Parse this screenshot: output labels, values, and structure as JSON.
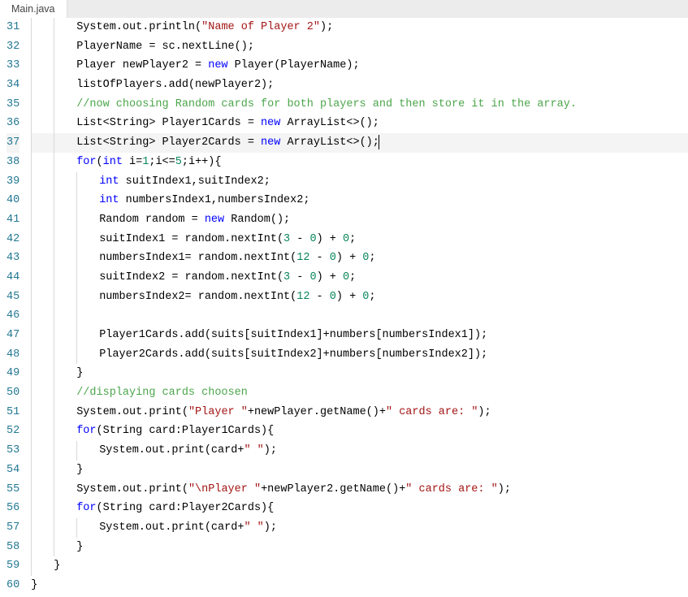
{
  "tab": {
    "filename": "Main.java"
  },
  "lines": [
    {
      "num": 31,
      "indent": 2,
      "tokens": [
        {
          "t": "System.out.println(",
          "c": "code"
        },
        {
          "t": "\"Name of Player 2\"",
          "c": "str"
        },
        {
          "t": ");",
          "c": "code"
        }
      ]
    },
    {
      "num": 32,
      "indent": 2,
      "tokens": [
        {
          "t": "PlayerName = sc.nextLine();",
          "c": "code"
        }
      ]
    },
    {
      "num": 33,
      "indent": 2,
      "tokens": [
        {
          "t": "Player newPlayer2 = ",
          "c": "code"
        },
        {
          "t": "new",
          "c": "kw"
        },
        {
          "t": " Player(PlayerName);",
          "c": "code"
        }
      ]
    },
    {
      "num": 34,
      "indent": 2,
      "tokens": [
        {
          "t": "listOfPlayers.add(newPlayer2);",
          "c": "code"
        }
      ]
    },
    {
      "num": 35,
      "indent": 2,
      "tokens": [
        {
          "t": "//now choosing Random cards for both players and then store it in the array.",
          "c": "cmt"
        }
      ]
    },
    {
      "num": 36,
      "indent": 2,
      "tokens": [
        {
          "t": "List<String> Player1Cards = ",
          "c": "code"
        },
        {
          "t": "new",
          "c": "kw"
        },
        {
          "t": " ArrayList<>();",
          "c": "code"
        }
      ]
    },
    {
      "num": 37,
      "indent": 2,
      "highlighted": true,
      "cursor": true,
      "tokens": [
        {
          "t": "List<String> Player2Cards = ",
          "c": "code"
        },
        {
          "t": "new",
          "c": "kw"
        },
        {
          "t": " ArrayList<>();",
          "c": "code"
        }
      ]
    },
    {
      "num": 38,
      "indent": 2,
      "tokens": [
        {
          "t": "for",
          "c": "kw"
        },
        {
          "t": "(",
          "c": "code"
        },
        {
          "t": "int",
          "c": "kw"
        },
        {
          "t": " i=",
          "c": "code"
        },
        {
          "t": "1",
          "c": "num"
        },
        {
          "t": ";i<=",
          "c": "code"
        },
        {
          "t": "5",
          "c": "num"
        },
        {
          "t": ";i++){",
          "c": "code"
        }
      ]
    },
    {
      "num": 39,
      "indent": 3,
      "tokens": [
        {
          "t": "int",
          "c": "kw"
        },
        {
          "t": " suitIndex1,suitIndex2;",
          "c": "code"
        }
      ]
    },
    {
      "num": 40,
      "indent": 3,
      "tokens": [
        {
          "t": "int",
          "c": "kw"
        },
        {
          "t": " numbersIndex1,numbersIndex2;",
          "c": "code"
        }
      ]
    },
    {
      "num": 41,
      "indent": 3,
      "tokens": [
        {
          "t": "Random random = ",
          "c": "code"
        },
        {
          "t": "new",
          "c": "kw"
        },
        {
          "t": " Random();",
          "c": "code"
        }
      ]
    },
    {
      "num": 42,
      "indent": 3,
      "tokens": [
        {
          "t": "suitIndex1 = random.nextInt(",
          "c": "code"
        },
        {
          "t": "3",
          "c": "num"
        },
        {
          "t": " - ",
          "c": "code"
        },
        {
          "t": "0",
          "c": "num"
        },
        {
          "t": ") + ",
          "c": "code"
        },
        {
          "t": "0",
          "c": "num"
        },
        {
          "t": ";",
          "c": "code"
        }
      ]
    },
    {
      "num": 43,
      "indent": 3,
      "tokens": [
        {
          "t": "numbersIndex1= random.nextInt(",
          "c": "code"
        },
        {
          "t": "12",
          "c": "num"
        },
        {
          "t": " - ",
          "c": "code"
        },
        {
          "t": "0",
          "c": "num"
        },
        {
          "t": ") + ",
          "c": "code"
        },
        {
          "t": "0",
          "c": "num"
        },
        {
          "t": ";",
          "c": "code"
        }
      ]
    },
    {
      "num": 44,
      "indent": 3,
      "tokens": [
        {
          "t": "suitIndex2 = random.nextInt(",
          "c": "code"
        },
        {
          "t": "3",
          "c": "num"
        },
        {
          "t": " - ",
          "c": "code"
        },
        {
          "t": "0",
          "c": "num"
        },
        {
          "t": ") + ",
          "c": "code"
        },
        {
          "t": "0",
          "c": "num"
        },
        {
          "t": ";",
          "c": "code"
        }
      ]
    },
    {
      "num": 45,
      "indent": 3,
      "tokens": [
        {
          "t": "numbersIndex2= random.nextInt(",
          "c": "code"
        },
        {
          "t": "12",
          "c": "num"
        },
        {
          "t": " - ",
          "c": "code"
        },
        {
          "t": "0",
          "c": "num"
        },
        {
          "t": ") + ",
          "c": "code"
        },
        {
          "t": "0",
          "c": "num"
        },
        {
          "t": ";",
          "c": "code"
        }
      ]
    },
    {
      "num": 46,
      "indent": 3,
      "tokens": []
    },
    {
      "num": 47,
      "indent": 3,
      "tokens": [
        {
          "t": "Player1Cards.add(suits[suitIndex1]+numbers[numbersIndex1]);",
          "c": "code"
        }
      ]
    },
    {
      "num": 48,
      "indent": 3,
      "tokens": [
        {
          "t": "Player2Cards.add(suits[suitIndex2]+numbers[numbersIndex2]);",
          "c": "code"
        }
      ]
    },
    {
      "num": 49,
      "indent": 2,
      "tokens": [
        {
          "t": "}",
          "c": "code"
        }
      ]
    },
    {
      "num": 50,
      "indent": 2,
      "tokens": [
        {
          "t": "//displaying cards choosen",
          "c": "cmt"
        }
      ]
    },
    {
      "num": 51,
      "indent": 2,
      "tokens": [
        {
          "t": "System.out.print(",
          "c": "code"
        },
        {
          "t": "\"Player \"",
          "c": "str"
        },
        {
          "t": "+newPlayer.getName()+",
          "c": "code"
        },
        {
          "t": "\" cards are: \"",
          "c": "str"
        },
        {
          "t": ");",
          "c": "code"
        }
      ]
    },
    {
      "num": 52,
      "indent": 2,
      "tokens": [
        {
          "t": "for",
          "c": "kw"
        },
        {
          "t": "(String card:Player1Cards){",
          "c": "code"
        }
      ]
    },
    {
      "num": 53,
      "indent": 3,
      "tokens": [
        {
          "t": "System.out.print(card+",
          "c": "code"
        },
        {
          "t": "\" \"",
          "c": "str"
        },
        {
          "t": ");",
          "c": "code"
        }
      ]
    },
    {
      "num": 54,
      "indent": 2,
      "tokens": [
        {
          "t": "}",
          "c": "code"
        }
      ]
    },
    {
      "num": 55,
      "indent": 2,
      "tokens": [
        {
          "t": "System.out.print(",
          "c": "code"
        },
        {
          "t": "\"\\nPlayer \"",
          "c": "str"
        },
        {
          "t": "+newPlayer2.getName()+",
          "c": "code"
        },
        {
          "t": "\" cards are: \"",
          "c": "str"
        },
        {
          "t": ");",
          "c": "code"
        }
      ]
    },
    {
      "num": 56,
      "indent": 2,
      "tokens": [
        {
          "t": "for",
          "c": "kw"
        },
        {
          "t": "(String card:Player2Cards){",
          "c": "code"
        }
      ]
    },
    {
      "num": 57,
      "indent": 3,
      "tokens": [
        {
          "t": "System.out.print(card+",
          "c": "code"
        },
        {
          "t": "\" \"",
          "c": "str"
        },
        {
          "t": ");",
          "c": "code"
        }
      ]
    },
    {
      "num": 58,
      "indent": 2,
      "tokens": [
        {
          "t": "}",
          "c": "code"
        }
      ]
    },
    {
      "num": 59,
      "indent": 1,
      "tokens": [
        {
          "t": "}",
          "c": "code"
        }
      ]
    },
    {
      "num": 60,
      "indent": 0,
      "tokens": [
        {
          "t": "}",
          "c": "code"
        }
      ]
    }
  ]
}
